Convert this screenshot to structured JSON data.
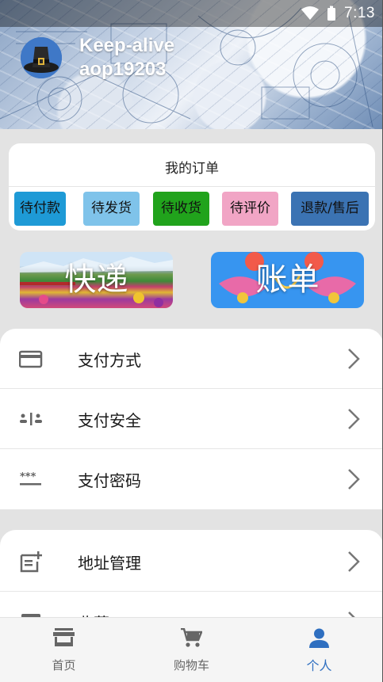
{
  "status_bar": {
    "time": "7:13",
    "icons": [
      "wifi-icon",
      "battery-icon"
    ]
  },
  "profile": {
    "username": "Keep-alive",
    "user_id": "aop19203",
    "avatar": "pilgrim-hat-avatar"
  },
  "orders": {
    "title": "我的订单",
    "buttons": [
      {
        "label": "待付款",
        "color": "#1e9ad6"
      },
      {
        "label": "待发货",
        "color": "#7fc3ea"
      },
      {
        "label": "待收货",
        "color": "#21a31c"
      },
      {
        "label": "待评价",
        "color": "#f1a5c5"
      },
      {
        "label": "退款/售后",
        "color": "#3b73b3"
      }
    ]
  },
  "banners": [
    {
      "label": "快递"
    },
    {
      "label": "账单"
    }
  ],
  "menu": {
    "group1": [
      {
        "label": "支付方式",
        "icon": "credit-card-icon"
      },
      {
        "label": "支付安全",
        "icon": "payment-security-icon"
      },
      {
        "label": "支付密码",
        "icon": "password-icon"
      }
    ],
    "group2": [
      {
        "label": "地址管理",
        "icon": "address-note-icon"
      },
      {
        "label": "收藏",
        "icon": "collection-icon"
      }
    ]
  },
  "bottom_nav": {
    "items": [
      {
        "label": "首页",
        "icon": "store-icon"
      },
      {
        "label": "购物车",
        "icon": "cart-icon"
      },
      {
        "label": "个人",
        "icon": "person-icon"
      }
    ],
    "active": "个人",
    "active_color": "#2f6fc0"
  }
}
